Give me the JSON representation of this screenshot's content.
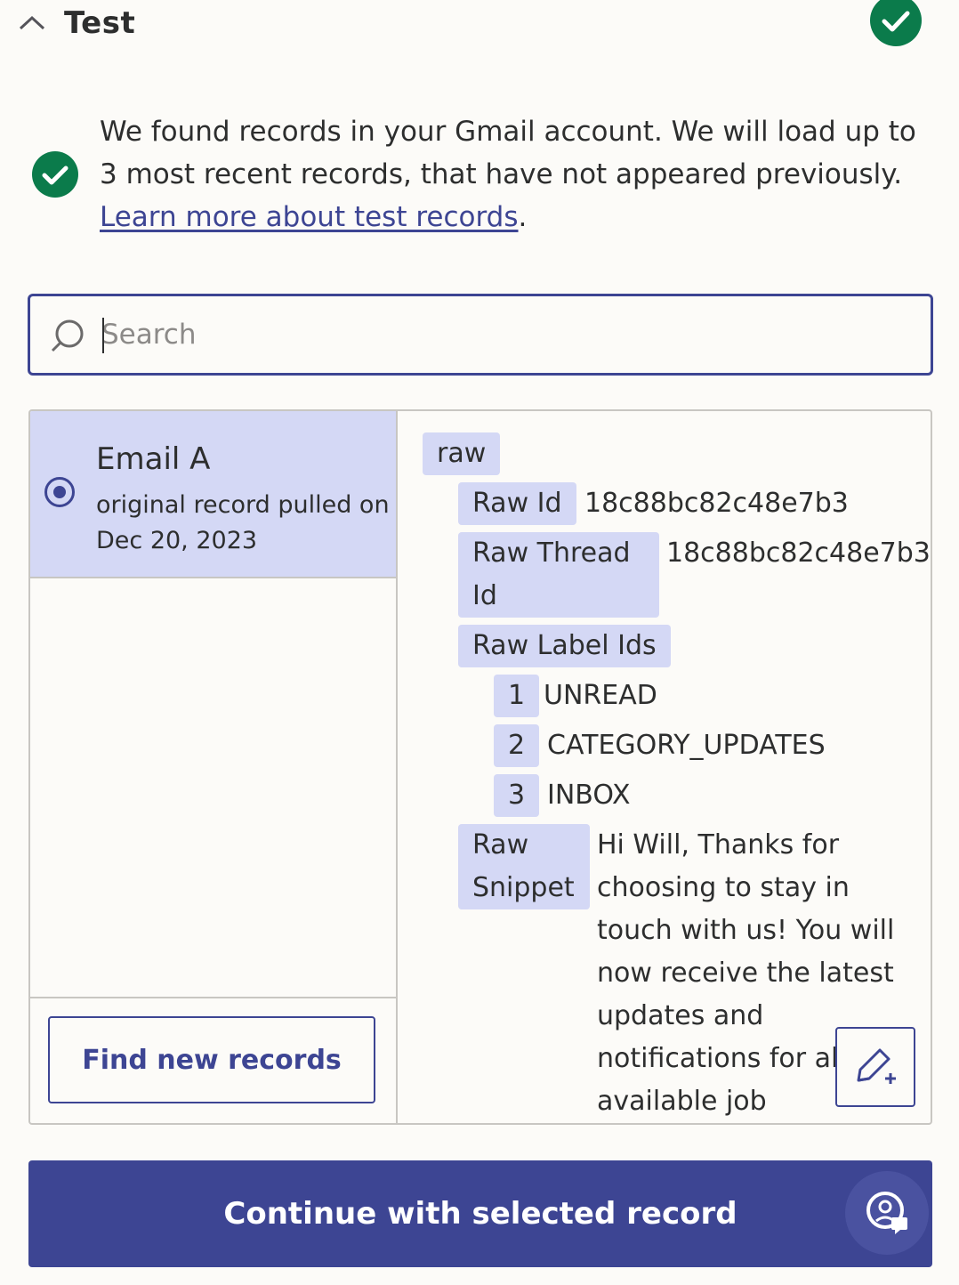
{
  "header": {
    "title": "Test",
    "status": "success"
  },
  "info": {
    "text": "We found records in your Gmail account. We will load up to 3 most recent records, that have not appeared previously. ",
    "link_text": "Learn more about test records",
    "trailing": "."
  },
  "search": {
    "placeholder": "Search",
    "value": ""
  },
  "records": [
    {
      "title": "Email A",
      "subtitle": "original record pulled on Dec 20, 2023",
      "selected": true
    }
  ],
  "find_button": "Find new records",
  "detail": {
    "root": "raw",
    "raw_id_label": "Raw Id",
    "raw_id_value": "18c88bc82c48e7b3",
    "raw_thread_label": "Raw Thread Id",
    "raw_thread_value": "18c88bc82c48e7b3",
    "raw_label_ids_label": "Raw Label Ids",
    "label_ids": [
      {
        "index": "1",
        "value": "UNREAD"
      },
      {
        "index": "2",
        "value": "CATEGORY_UPDATES"
      },
      {
        "index": "3",
        "value": "INBOX"
      }
    ],
    "raw_snippet_label": "Raw Snippet",
    "raw_snippet_value": "Hi Will, Thanks for choosing to stay in touch with us! You will now receive the latest updates and notifications for all available job"
  },
  "continue_button": "Continue with selected record",
  "colors": {
    "accent": "#3d4593",
    "success": "#0b7b4b",
    "selected_bg": "#d4d8f5"
  }
}
